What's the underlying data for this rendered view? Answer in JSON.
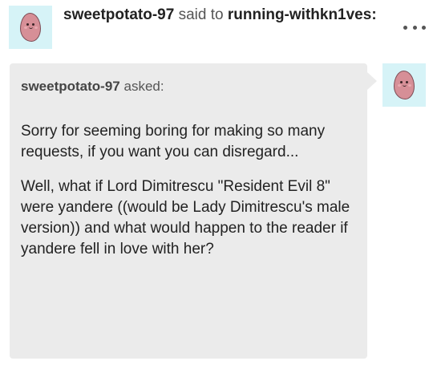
{
  "post": {
    "author": "sweetpotato-97",
    "said_to": "said to",
    "recipient": "running-withkn1ves:",
    "avatar_icon": "potato-avatar-icon",
    "more_icon": "ellipsis-icon"
  },
  "ask": {
    "asker": "sweetpotato-97",
    "asked_label": "asked:",
    "paragraphs": [
      "Sorry for seeming boring for making so many requests, if you want you can disregard...",
      "Well, what if Lord Dimitrescu \"Resident Evil 8\" were yandere ((would be Lady Dimitrescu's male version)) and what would happen to the reader if yandere fell in love with her?"
    ],
    "avatar_icon": "potato-avatar-icon"
  },
  "colors": {
    "avatar_bg": "#d6f3f7",
    "potato": "#d68f97",
    "ask_bg": "#ebebeb"
  }
}
